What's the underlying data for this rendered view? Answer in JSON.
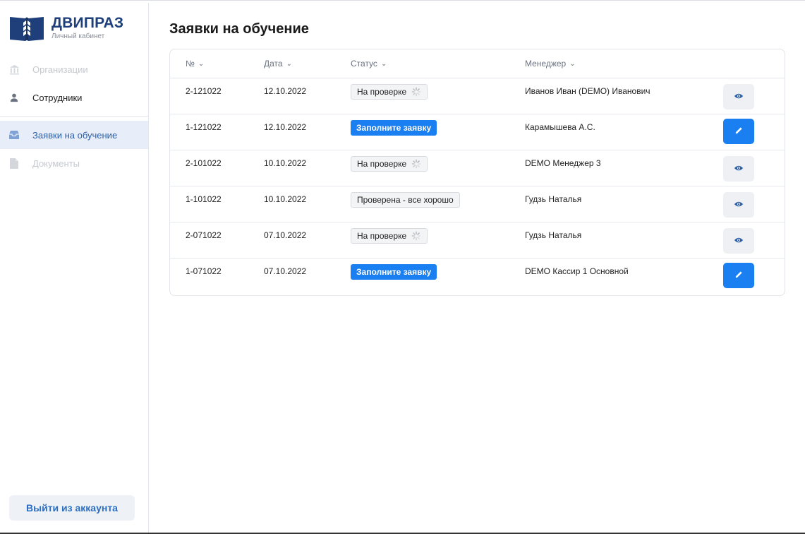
{
  "brand": {
    "title": "ДВИПРАЗ",
    "subtitle": "Личный кабинет",
    "color": "#1e3f7a"
  },
  "sidebar": {
    "items": [
      {
        "label": "Организации",
        "icon": "building-icon",
        "state": "disabled"
      },
      {
        "label": "Сотрудники",
        "icon": "person-icon",
        "state": "normal"
      },
      {
        "label": "Заявки на обучение",
        "icon": "inbox-icon",
        "state": "active"
      },
      {
        "label": "Документы",
        "icon": "document-icon",
        "state": "disabled"
      }
    ],
    "logout_label": "Выйти из аккаунта"
  },
  "main": {
    "title": "Заявки на обучение",
    "columns": [
      {
        "label": "№"
      },
      {
        "label": "Дата"
      },
      {
        "label": "Статус"
      },
      {
        "label": "Менеджер"
      }
    ],
    "rows": [
      {
        "number": "2-121022",
        "date": "12.10.2022",
        "status": "На проверке",
        "status_type": "review",
        "manager": "Иванов Иван (DEMO) Иванович",
        "action": "view"
      },
      {
        "number": "1-121022",
        "date": "12.10.2022",
        "status": "Заполните заявку",
        "status_type": "fill",
        "manager": "Карамышева А.С.",
        "action": "edit"
      },
      {
        "number": "2-101022",
        "date": "10.10.2022",
        "status": "На проверке",
        "status_type": "review",
        "manager": "DEMO Менеджер 3",
        "action": "view"
      },
      {
        "number": "1-101022",
        "date": "10.10.2022",
        "status": "Проверена - все хорошо",
        "status_type": "ok",
        "manager": "Гудзь Наталья",
        "action": "view"
      },
      {
        "number": "2-071022",
        "date": "07.10.2022",
        "status": "На проверке",
        "status_type": "review",
        "manager": "Гудзь Наталья",
        "action": "view"
      },
      {
        "number": "1-071022",
        "date": "07.10.2022",
        "status": "Заполните заявку",
        "status_type": "fill",
        "manager": "DEMO Кассир 1 Основной",
        "action": "edit"
      }
    ]
  },
  "colors": {
    "accent": "#1a7ff0",
    "active_nav_bg": "#e8eef9",
    "view_button_bg": "#eef0f3"
  }
}
